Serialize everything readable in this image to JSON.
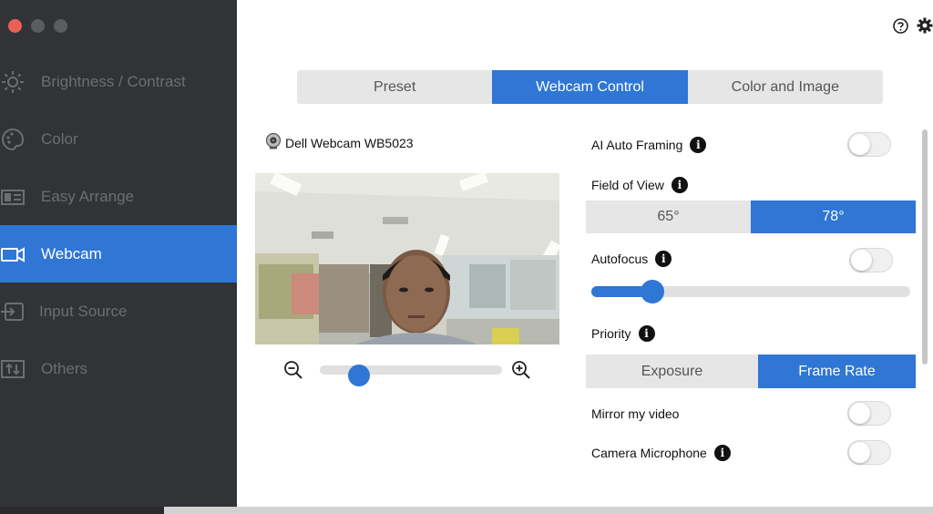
{
  "sidebar": {
    "items": [
      {
        "label": "Brightness / Contrast",
        "icon": "brightness-icon",
        "active": false
      },
      {
        "label": "Color",
        "icon": "palette-icon",
        "active": false
      },
      {
        "label": "Easy Arrange",
        "icon": "layout-icon",
        "active": false
      },
      {
        "label": "Webcam",
        "icon": "webcam-icon",
        "active": true
      },
      {
        "label": "Input Source",
        "icon": "input-source-icon",
        "active": false
      },
      {
        "label": "Others",
        "icon": "others-icon",
        "active": false
      }
    ]
  },
  "tabs": [
    "Preset",
    "Webcam Control",
    "Color and Image"
  ],
  "active_tab": "Webcam Control",
  "camera": {
    "name": "Dell Webcam WB5023",
    "zoom_level": 0.0
  },
  "settings": {
    "ai_auto_framing": {
      "label": "AI Auto Framing",
      "on": false
    },
    "field_of_view": {
      "label": "Field of View",
      "options": [
        "65°",
        "78°"
      ],
      "selected": "78°"
    },
    "autofocus": {
      "label": "Autofocus",
      "on": false,
      "slider_value": 0.19
    },
    "priority": {
      "label": "Priority",
      "options": [
        "Exposure",
        "Frame Rate"
      ],
      "selected": "Frame Rate"
    },
    "mirror": {
      "label": "Mirror my video",
      "on": false
    },
    "microphone": {
      "label": "Camera Microphone",
      "on": false
    }
  },
  "colors": {
    "accent": "#2f76d5",
    "sidebar_bg": "#323337",
    "close": "#ec5f57"
  }
}
